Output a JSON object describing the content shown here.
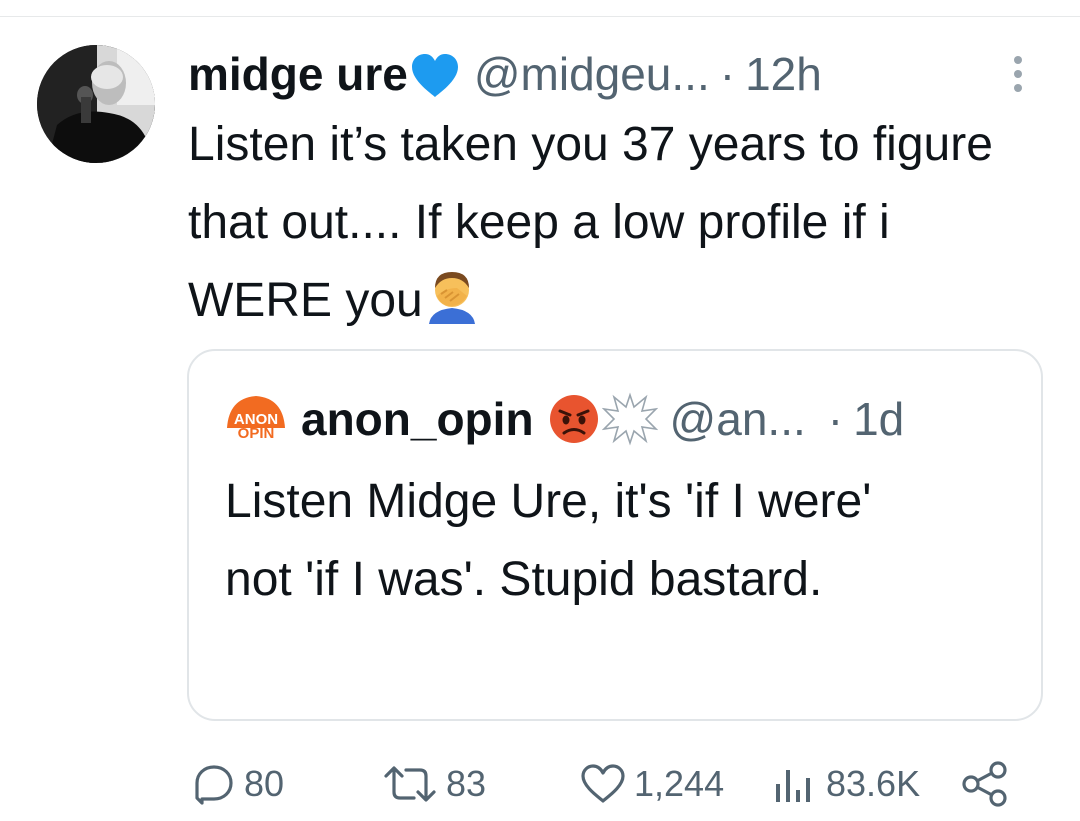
{
  "tweet": {
    "display_name": "midge ure",
    "handle": "@midgeu...",
    "separator": "·",
    "time": "12h",
    "text": "Listen it’s taken you 37 years to figure that out.... If keep a low profile if i WERE you",
    "trailing_emoji": "face-palm-emoji",
    "verified_badge_color": "#1d9bf0"
  },
  "quote": {
    "avatar_text_line1": "ANON",
    "avatar_text_line2": "OPIN",
    "avatar_color": "#f26b21",
    "display_name": "anon_opin",
    "name_emojis": [
      "angry-face-emoji",
      "anger-symbol-emoji"
    ],
    "handle": "@an...",
    "separator": "·",
    "time": "1d",
    "text": "Listen Midge Ure, it's 'if I were' not 'if I was'. Stupid bastard."
  },
  "actions": {
    "replies": "80",
    "retweets": "83",
    "likes": "1,244",
    "views": "83.6K"
  },
  "colors": {
    "text_primary": "#0f1419",
    "text_secondary": "#536471",
    "border": "#e1e5e8"
  }
}
